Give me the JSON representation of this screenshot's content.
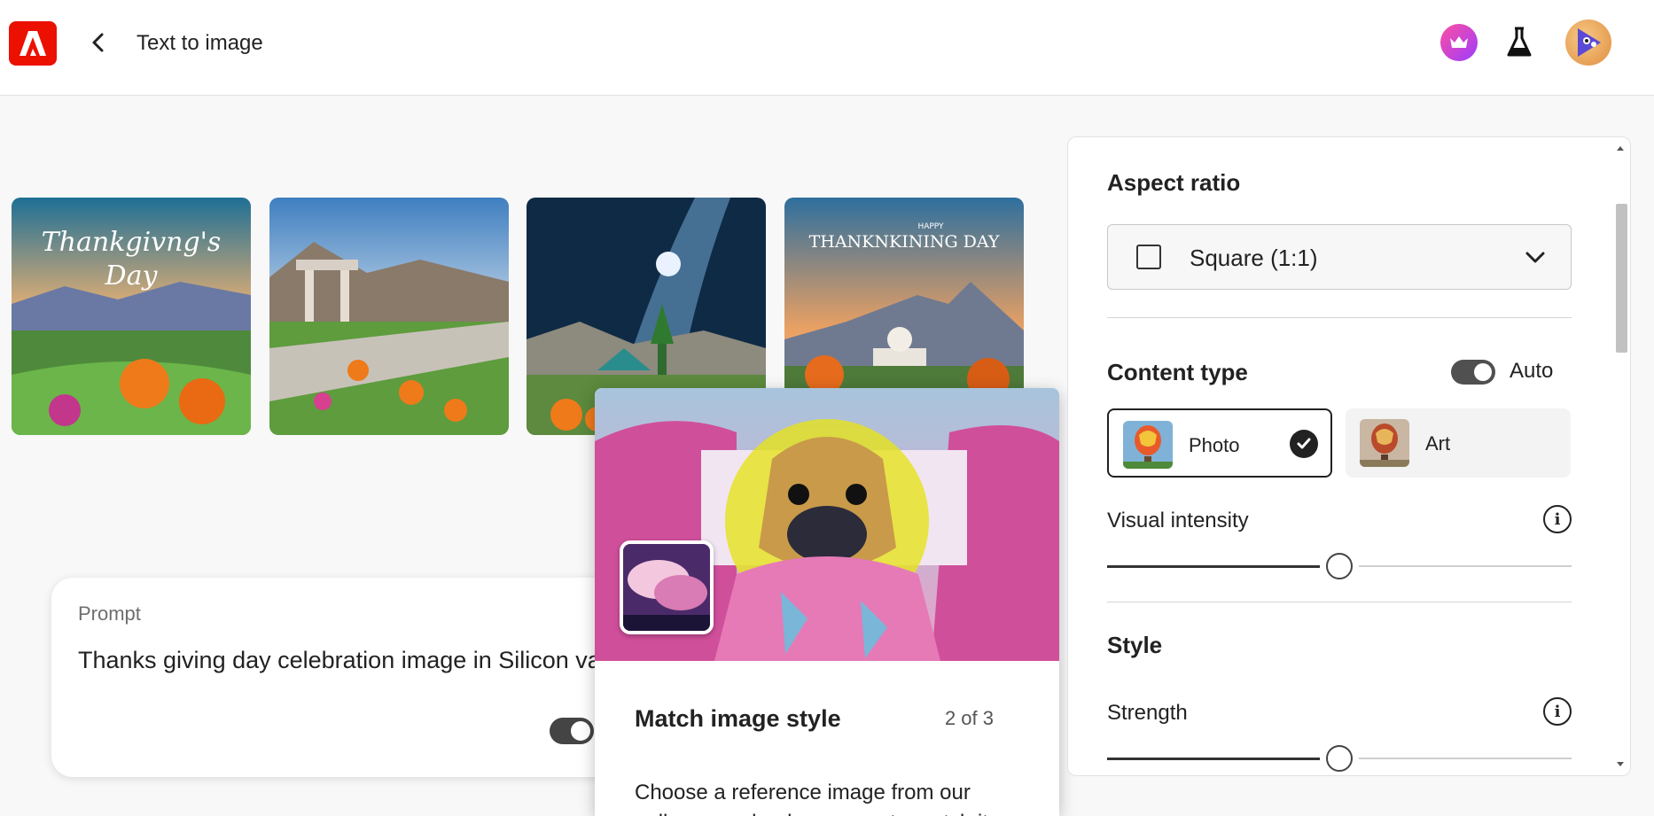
{
  "header": {
    "title": "Text to image"
  },
  "gallery": {
    "images": [
      {
        "overlay_text_line1": "Thankgivng's",
        "overlay_text_line2": "Day"
      },
      {
        "overlay_text_line1": "",
        "overlay_text_line2": ""
      },
      {
        "overlay_text_line1": "",
        "overlay_text_line2": ""
      },
      {
        "overlay_text_line1": "HAPPY",
        "overlay_text_line2": "THANKNKINING DAY"
      }
    ]
  },
  "prompt": {
    "label": "Prompt",
    "text": "Thanks giving day celebration image in Silicon va"
  },
  "popover": {
    "title": "Match image style",
    "count": "2 of 3",
    "body": "Choose a reference image from our gallery or upload your own to match its"
  },
  "panel": {
    "aspect_ratio": {
      "title": "Aspect ratio",
      "selected": "Square (1:1)"
    },
    "content_type": {
      "title": "Content type",
      "auto_label": "Auto",
      "options": [
        {
          "label": "Photo",
          "selected": true
        },
        {
          "label": "Art",
          "selected": false
        }
      ]
    },
    "visual_intensity": {
      "label": "Visual intensity",
      "value": 0.5
    },
    "style": {
      "title": "Style",
      "strength_label": "Strength",
      "strength_value": 0.5
    }
  },
  "colors": {
    "brand": "#eb1000",
    "accent_dark": "#222222"
  },
  "icons": [
    "adobe-logo-icon",
    "chevron-left-icon",
    "crown-icon",
    "flask-icon",
    "avatar",
    "chevron-down-icon",
    "info-icon",
    "checkmark-icon"
  ]
}
